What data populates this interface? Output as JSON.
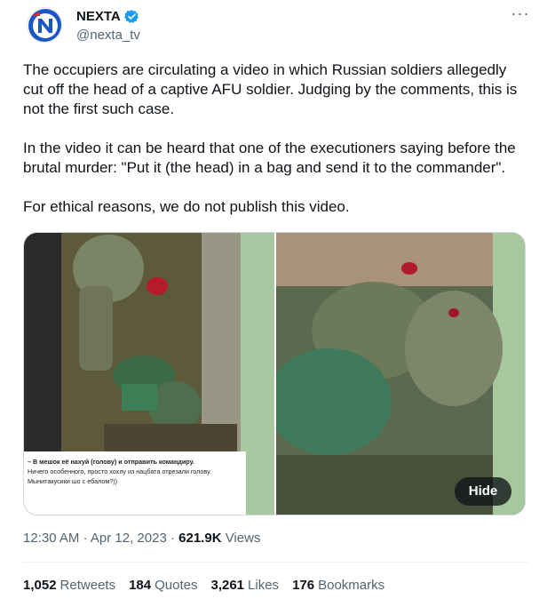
{
  "header": {
    "display_name": "NEXTA",
    "handle": "@nexta_tv",
    "more_label": "···",
    "avatar_icon": "nexta-logo-icon",
    "verified_icon": "verified-badge-icon",
    "brand_color": "#1d9bf0"
  },
  "tweet": {
    "paragraphs": [
      "The occupiers are circulating a video in which Russian soldiers allegedly cut off the head of a captive AFU soldier. Judging by the comments, this is not the first such case.",
      "In the video it can be heard that one of the executioners saying before the brutal murder: \"Put it (the head) in a bag and send it to the commander\".",
      "For ethical reasons, we do not publish this video."
    ]
  },
  "media": {
    "caption_lines": [
      "– В мешок её нахуй (голову) и отправить командиру.",
      "Ничего особенного, просто хохлу из нацбата отрезали голову.",
      "Мынитакусики шо с ебалом?))"
    ],
    "hide_label": "Hide"
  },
  "meta": {
    "time": "12:30 AM",
    "date": "Apr 12, 2023",
    "views_count": "621.9K",
    "views_label": "Views"
  },
  "stats": [
    {
      "count": "1,052",
      "label": "Retweets"
    },
    {
      "count": "184",
      "label": "Quotes"
    },
    {
      "count": "3,261",
      "label": "Likes"
    },
    {
      "count": "176",
      "label": "Bookmarks"
    }
  ]
}
